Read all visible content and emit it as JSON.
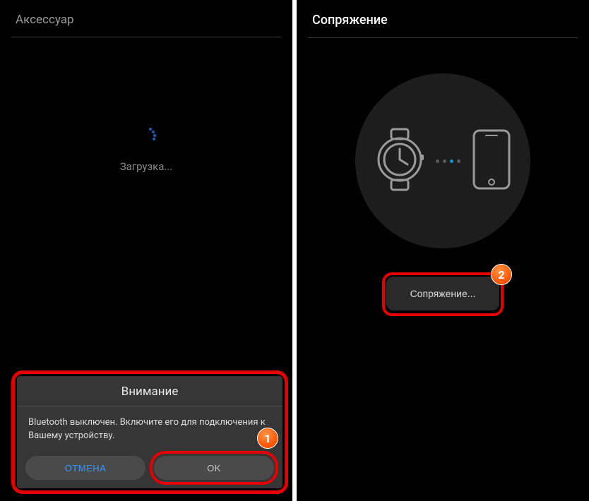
{
  "left": {
    "title": "Аксессуар",
    "loading": "Загрузка..."
  },
  "right": {
    "title": "Сопряжение",
    "pair_button": "Сопряжение..."
  },
  "dialog": {
    "title": "Внимание",
    "body": "Bluetooth выключен. Включите его для подключения к Вашему устройству.",
    "cancel": "ОТМЕНА",
    "ok": "OK"
  },
  "annotations": {
    "badge1": "1",
    "badge2": "2"
  }
}
